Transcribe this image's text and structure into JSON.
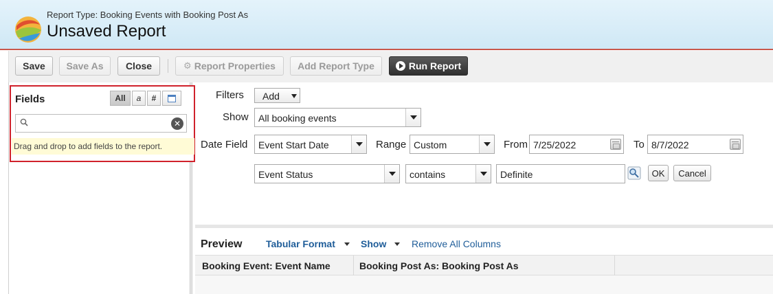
{
  "header": {
    "report_type": "Report Type: Booking Events with Booking Post As",
    "title": "Unsaved Report"
  },
  "toolbar": {
    "save": "Save",
    "save_as": "Save As",
    "close": "Close",
    "report_properties": "Report Properties",
    "add_report_type": "Add Report Type",
    "run_report": "Run Report"
  },
  "fields_panel": {
    "title": "Fields",
    "filters": [
      "All",
      "a",
      "#",
      ""
    ],
    "hint": "Drag and drop to add fields to the report."
  },
  "filters": {
    "filters_label": "Filters",
    "add_label": "Add",
    "show_label": "Show",
    "show_value": "All booking events",
    "date_field_label": "Date Field",
    "date_field_value": "Event Start Date",
    "range_label": "Range",
    "range_value": "Custom",
    "from_label": "From",
    "from_value": "7/25/2022",
    "to_label": "To",
    "to_value": "8/7/2022",
    "filter_field": "Event Status",
    "filter_operator": "contains",
    "filter_value": "Definite",
    "ok_label": "OK",
    "cancel_label": "Cancel"
  },
  "preview": {
    "title": "Preview",
    "format": "Tabular Format",
    "show": "Show",
    "remove_all": "Remove All Columns",
    "columns": [
      "Booking Event: Event Name",
      "Booking Post As: Booking Post As"
    ]
  },
  "colors": {
    "accent_red": "#d0212b",
    "link_blue": "#1f5d99",
    "header_bg": "#d8edf8"
  }
}
